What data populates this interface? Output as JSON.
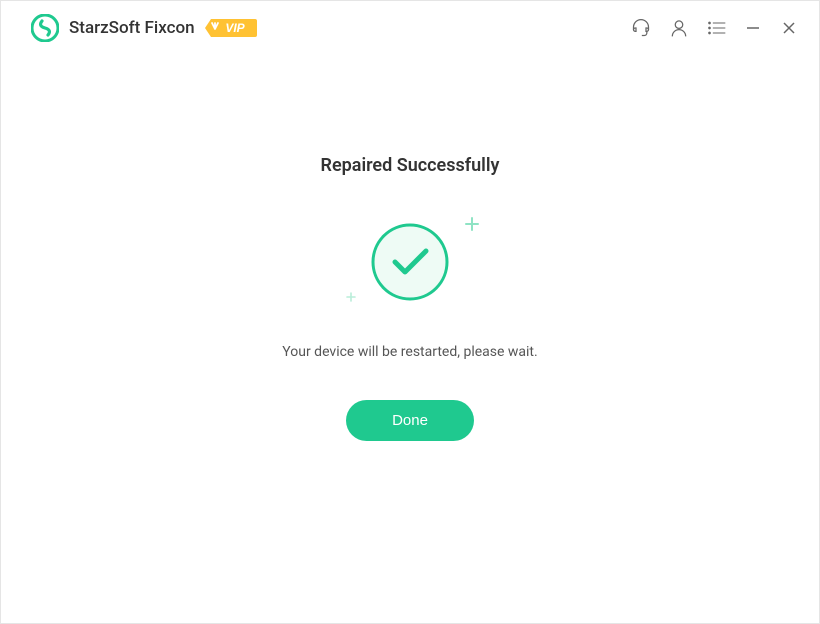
{
  "window": {
    "title": "StarzSoft Fixcon",
    "vip_label": "VIP"
  },
  "content": {
    "heading": "Repaired Successfully",
    "subtitle": "Your device will be restarted, please wait.",
    "done_button_label": "Done"
  },
  "colors": {
    "accent": "#1fc98f",
    "vip_bg": "#ffc233"
  }
}
